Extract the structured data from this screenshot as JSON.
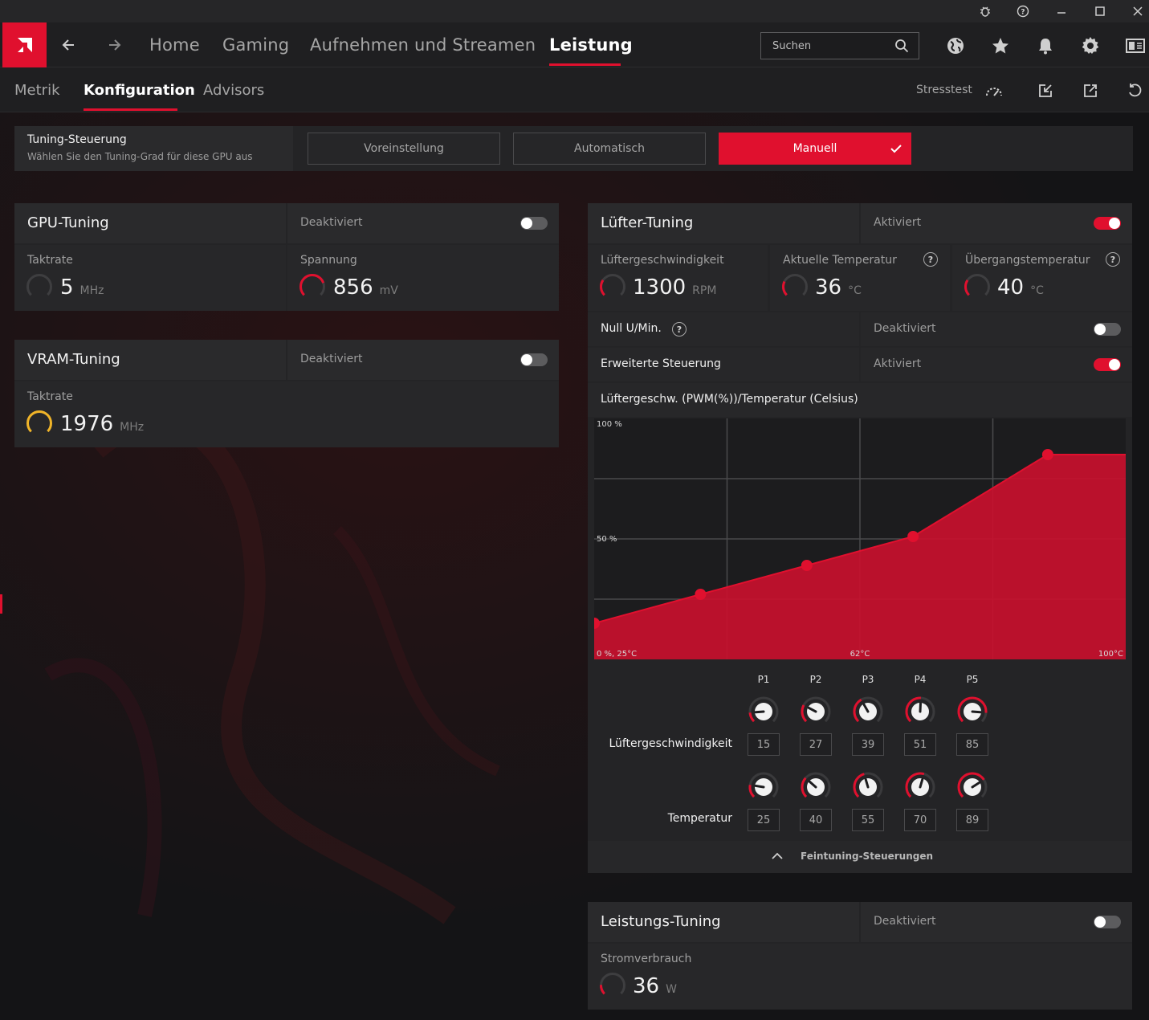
{
  "window": {
    "controls": [
      "bug-icon",
      "help-icon",
      "minimize-icon",
      "maximize-icon",
      "close-icon"
    ]
  },
  "nav": {
    "tabs": [
      {
        "label": "Home"
      },
      {
        "label": "Gaming"
      },
      {
        "label": "Aufnehmen und Streamen"
      },
      {
        "label": "Leistung",
        "active": true
      }
    ],
    "search_placeholder": "Suchen"
  },
  "subnav": {
    "tabs": [
      {
        "label": "Metrik"
      },
      {
        "label": "Konfiguration",
        "active": true
      },
      {
        "label": "Advisors"
      }
    ],
    "stress_test": "Stresstest"
  },
  "tuning_control": {
    "title": "Tuning-Steuerung",
    "subtitle": "Wählen Sie den Tuning-Grad für diese GPU aus",
    "options": [
      "Voreinstellung",
      "Automatisch",
      "Manuell"
    ],
    "selected": "Manuell"
  },
  "gpu_tuning": {
    "title": "GPU-Tuning",
    "status": "Deaktiviert",
    "enabled": false,
    "clock": {
      "label": "Taktrate",
      "value": "5",
      "unit": "MHz"
    },
    "voltage": {
      "label": "Spannung",
      "value": "856",
      "unit": "mV"
    }
  },
  "vram_tuning": {
    "title": "VRAM-Tuning",
    "status": "Deaktiviert",
    "enabled": false,
    "clock": {
      "label": "Taktrate",
      "value": "1976",
      "unit": "MHz"
    }
  },
  "fan_tuning": {
    "title": "Lüfter-Tuning",
    "status": "Aktiviert",
    "enabled": true,
    "fan_speed": {
      "label": "Lüftergeschwindigkeit",
      "value": "1300",
      "unit": "RPM"
    },
    "current_temp": {
      "label": "Aktuelle Temperatur",
      "value": "36",
      "unit": "°C"
    },
    "junction_temp": {
      "label": "Übergangstemperatur",
      "value": "40",
      "unit": "°C"
    },
    "zero_rpm": {
      "label": "Null U/Min.",
      "status": "Deaktiviert",
      "enabled": false
    },
    "advanced": {
      "label": "Erweiterte Steuerung",
      "status": "Aktiviert",
      "enabled": true
    },
    "curve_title": "Lüftergeschw. (PWM(%))/Temperatur (Celsius)",
    "axis": {
      "y_top": "100 %",
      "y_mid": "50 %",
      "origin": "0 %, 25°C",
      "x_mid": "62°C",
      "x_max": "100°C"
    },
    "points": [
      "P1",
      "P2",
      "P3",
      "P4",
      "P5"
    ],
    "speed_label": "Lüftergeschwindigkeit",
    "temp_label": "Temperatur",
    "speeds": [
      "15",
      "27",
      "39",
      "51",
      "85"
    ],
    "temps": [
      "25",
      "40",
      "55",
      "70",
      "89"
    ],
    "fine_tuning": "Feintuning-Steuerungen"
  },
  "chart_data": {
    "type": "area",
    "x": [
      25,
      40,
      55,
      70,
      89,
      100
    ],
    "values": [
      15,
      27,
      39,
      51,
      85,
      85
    ],
    "xlim": [
      25,
      100
    ],
    "ylim": [
      0,
      100
    ],
    "grid": true,
    "color": "#c8102e"
  },
  "power_tuning": {
    "title": "Leistungs-Tuning",
    "status": "Deaktiviert",
    "enabled": false,
    "power": {
      "label": "Stromverbrauch",
      "value": "36",
      "unit": "W"
    }
  },
  "colors": {
    "accent": "#e0102e",
    "gauge_vram": "#f0b428"
  }
}
